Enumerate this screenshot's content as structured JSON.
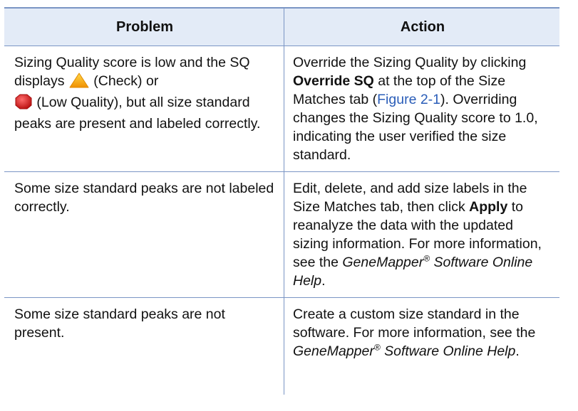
{
  "header": {
    "problem": "Problem",
    "action": "Action"
  },
  "rows": [
    {
      "problem": {
        "t1": "Sizing Quality score is low and the SQ displays ",
        "t2": " (Check) or",
        "t3": " (Low Quality), but all size standard peaks are present and labeled correctly."
      },
      "action": {
        "t1": "Override the Sizing Quality by clicking ",
        "b1": "Override SQ",
        "t2": " at the top of the Size Matches tab (",
        "link": "Figure 2-1",
        "t3": "). Overriding changes the Sizing Quality score to 1.0, indicating the user verified the size standard."
      }
    },
    {
      "problem": {
        "t1": "Some size standard peaks are not labeled correctly."
      },
      "action": {
        "t1": "Edit, delete, and add size labels in the Size Matches tab, then click ",
        "b1": "Apply",
        "t2": " to reanalyze the data with the updated sizing information. For more information, see the ",
        "i1": "GeneMapper",
        "sup": "®",
        "i2": " Software Online Help",
        "t3": "."
      }
    },
    {
      "problem": {
        "t1": "Some size standard peaks are not present."
      },
      "action": {
        "t1": "Create a custom size standard in the software. For more information, see the ",
        "i1": "GeneMapper",
        "sup": "®",
        "i2": " Software Online Help",
        "t3": "."
      }
    }
  ],
  "icons": {
    "check": "warning-triangle-icon",
    "low_quality": "stop-octagon-icon"
  },
  "colors": {
    "border": "#7a95c4",
    "header_bg": "#e3ebf7",
    "link": "#2a5db8",
    "check_icon": "#f5b400",
    "low_quality_icon": "#d42020"
  }
}
